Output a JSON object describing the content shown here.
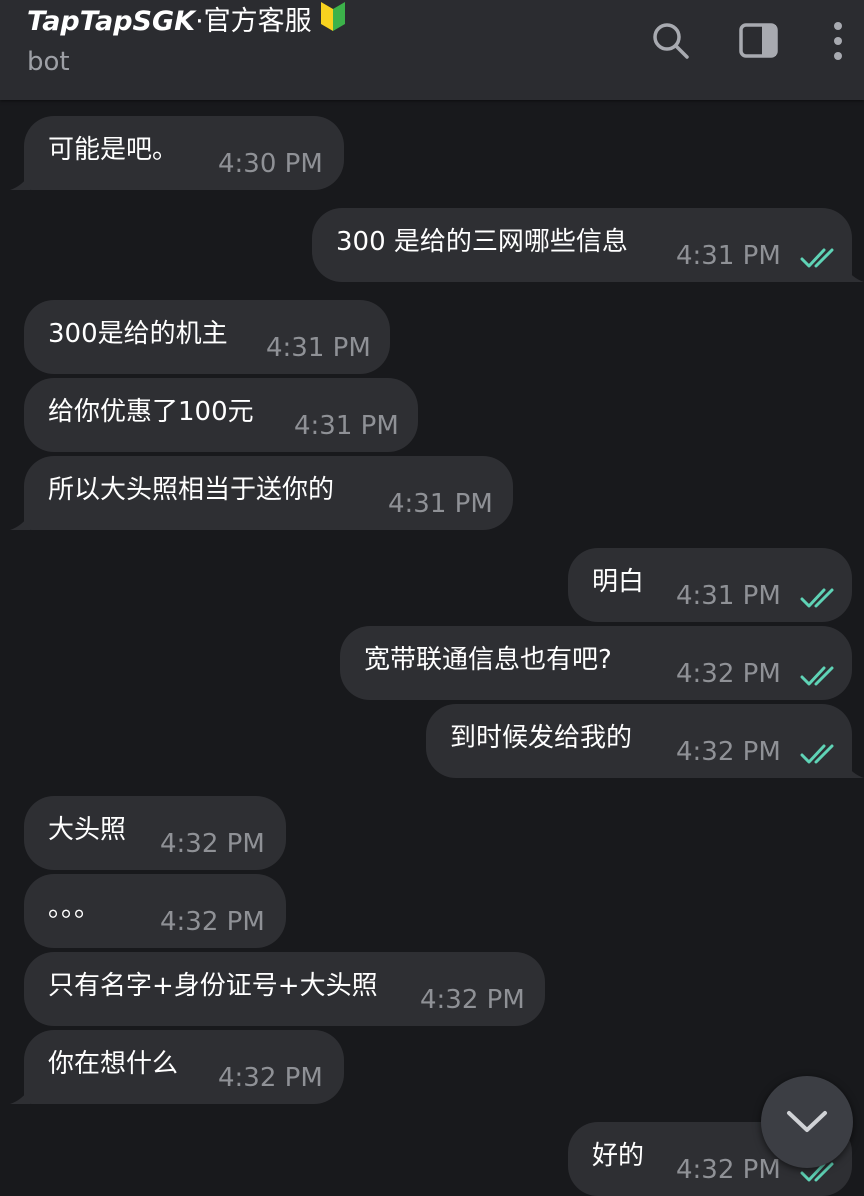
{
  "header": {
    "title_bold": "TapTapSGK",
    "title_rest": "·官方客服",
    "subtitle": "bot",
    "badge_icon": "beginner-badge-icon",
    "actions": [
      "search-icon",
      "sidebar-toggle-icon",
      "more-vertical-icon"
    ]
  },
  "messages": [
    {
      "text": "可能是吧。",
      "time": "4:30 PM",
      "dir": "in"
    },
    {
      "text": "300 是给的三网哪些信息",
      "time": "4:31 PM",
      "dir": "out",
      "read": true
    },
    {
      "text": "300是给的机主",
      "time": "4:31 PM",
      "dir": "in"
    },
    {
      "text": "给你优惠了100元",
      "time": "4:31 PM",
      "dir": "in"
    },
    {
      "text": "所以大头照相当于送你的",
      "time": "4:31 PM",
      "dir": "in"
    },
    {
      "text": "明白",
      "time": "4:31 PM",
      "dir": "out",
      "read": true
    },
    {
      "text": "宽带联通信息也有吧?",
      "time": "4:32 PM",
      "dir": "out",
      "read": true
    },
    {
      "text": "到时候发给我的",
      "time": "4:32 PM",
      "dir": "out",
      "read": true
    },
    {
      "text": "大头照",
      "time": "4:32 PM",
      "dir": "in"
    },
    {
      "text": "。。。",
      "time": "4:32 PM",
      "dir": "in"
    },
    {
      "text": "只有名字+身份证号+大头照",
      "time": "4:32 PM",
      "dir": "in"
    },
    {
      "text": "你在想什么",
      "time": "4:32 PM",
      "dir": "in"
    },
    {
      "text": "好的",
      "time": "4:32 PM",
      "dir": "out",
      "read": true
    }
  ],
  "scroll_down_icon": "chevron-down-icon",
  "colors": {
    "background": "#18191c",
    "header": "#2b2c30",
    "bubble": "#2e2f33",
    "read_check": "#5fd3b6"
  }
}
